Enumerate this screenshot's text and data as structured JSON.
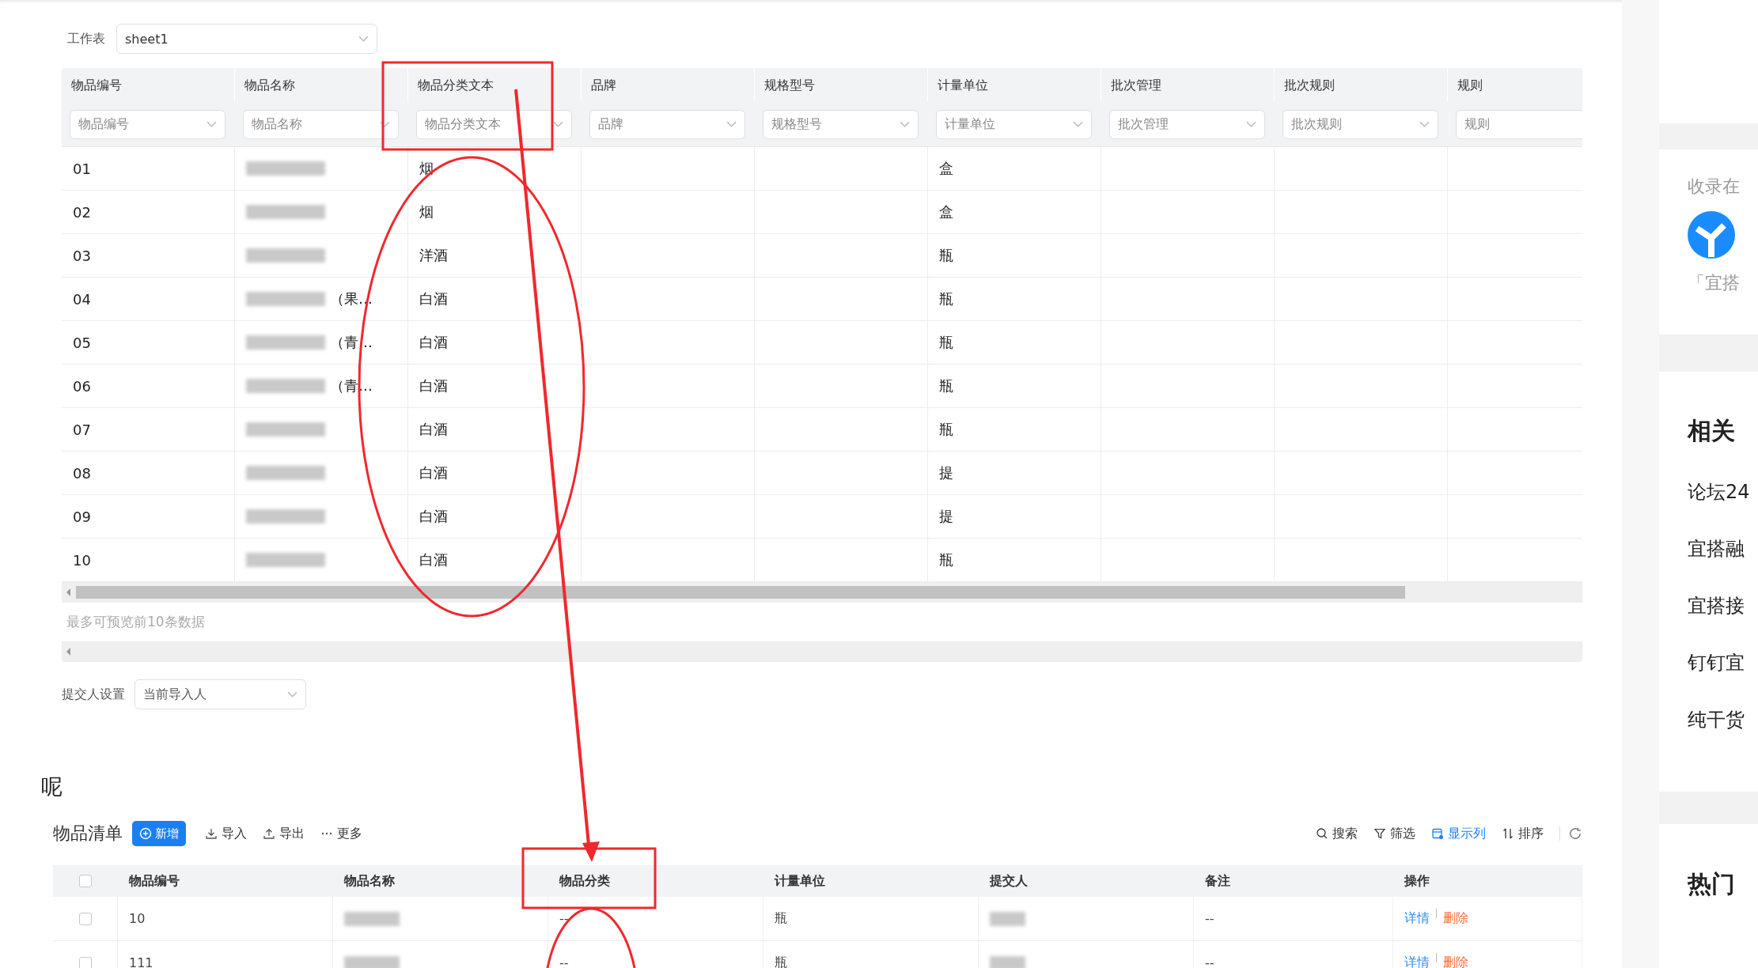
{
  "worksheet": {
    "label": "工作表",
    "value": "sheet1"
  },
  "preview": {
    "columns": [
      {
        "header": "物品编号",
        "filter": "物品编号"
      },
      {
        "header": "物品名称",
        "filter": "物品名称"
      },
      {
        "header": "物品分类文本",
        "filter": "物品分类文本"
      },
      {
        "header": "品牌",
        "filter": "品牌"
      },
      {
        "header": "规格型号",
        "filter": "规格型号"
      },
      {
        "header": "计量单位",
        "filter": "计量单位"
      },
      {
        "header": "批次管理",
        "filter": "批次管理"
      },
      {
        "header": "批次规则",
        "filter": "批次规则"
      },
      {
        "header": "规则",
        "filter": "规则"
      }
    ],
    "rows": [
      {
        "code": "01",
        "category": "烟",
        "unit": "盒"
      },
      {
        "code": "02",
        "category": "烟",
        "unit": "盒"
      },
      {
        "code": "03",
        "category": "洋酒",
        "unit": "瓶"
      },
      {
        "code": "04",
        "name_visible": "（果…",
        "category": "白酒",
        "unit": "瓶"
      },
      {
        "code": "05",
        "name_visible": "（青…",
        "category": "白酒",
        "unit": "瓶"
      },
      {
        "code": "06",
        "name_visible": "（青…",
        "category": "白酒",
        "unit": "瓶"
      },
      {
        "code": "07",
        "category": "白酒",
        "unit": "瓶"
      },
      {
        "code": "08",
        "category": "白酒",
        "unit": "提"
      },
      {
        "code": "09",
        "category": "白酒",
        "unit": "提"
      },
      {
        "code": "10",
        "category": "白酒",
        "unit": "瓶"
      }
    ],
    "note": "最多可预览前10条数据"
  },
  "submitter": {
    "label": "提交人设置",
    "value": "当前导入人"
  },
  "heading": "呢",
  "list": {
    "title": "物品清单",
    "actions": [
      {
        "kind": "add",
        "label": "新增"
      },
      {
        "kind": "import",
        "label": "导入"
      },
      {
        "kind": "export",
        "label": "导出"
      },
      {
        "kind": "more",
        "label": "更多"
      }
    ],
    "tools": [
      {
        "kind": "search",
        "label": "搜索",
        "selected": false
      },
      {
        "kind": "filter",
        "label": "筛选",
        "selected": false
      },
      {
        "kind": "columns",
        "label": "显示列",
        "selected": true
      },
      {
        "kind": "sort",
        "label": "排序",
        "selected": false
      },
      {
        "kind": "refresh"
      }
    ],
    "all_checked": false,
    "columns": [
      "物品编号",
      "物品名称",
      "物品分类",
      "计量单位",
      "提交人",
      "备注",
      "操作"
    ],
    "rows": [
      {
        "checked": false,
        "code": "10",
        "category": "--",
        "unit": "瓶",
        "note": "--",
        "actions": [
          {
            "kind": "detail",
            "label": "详情"
          },
          {
            "kind": "delete",
            "label": "删除"
          }
        ]
      },
      {
        "checked": false,
        "code": "111",
        "category": "--",
        "unit": "瓶",
        "note": "--",
        "actions": [
          {
            "kind": "detail",
            "label": "详情"
          },
          {
            "kind": "delete",
            "label": "删除"
          }
        ]
      }
    ]
  },
  "sidebar": {
    "collected_label": "收录在",
    "collection_name": "「宜搭",
    "related_title": "相关",
    "related_items": [
      "论坛24",
      "宜搭融",
      "宜搭接",
      "钉钉宜",
      "纯干货"
    ],
    "hot_title": "热门"
  }
}
